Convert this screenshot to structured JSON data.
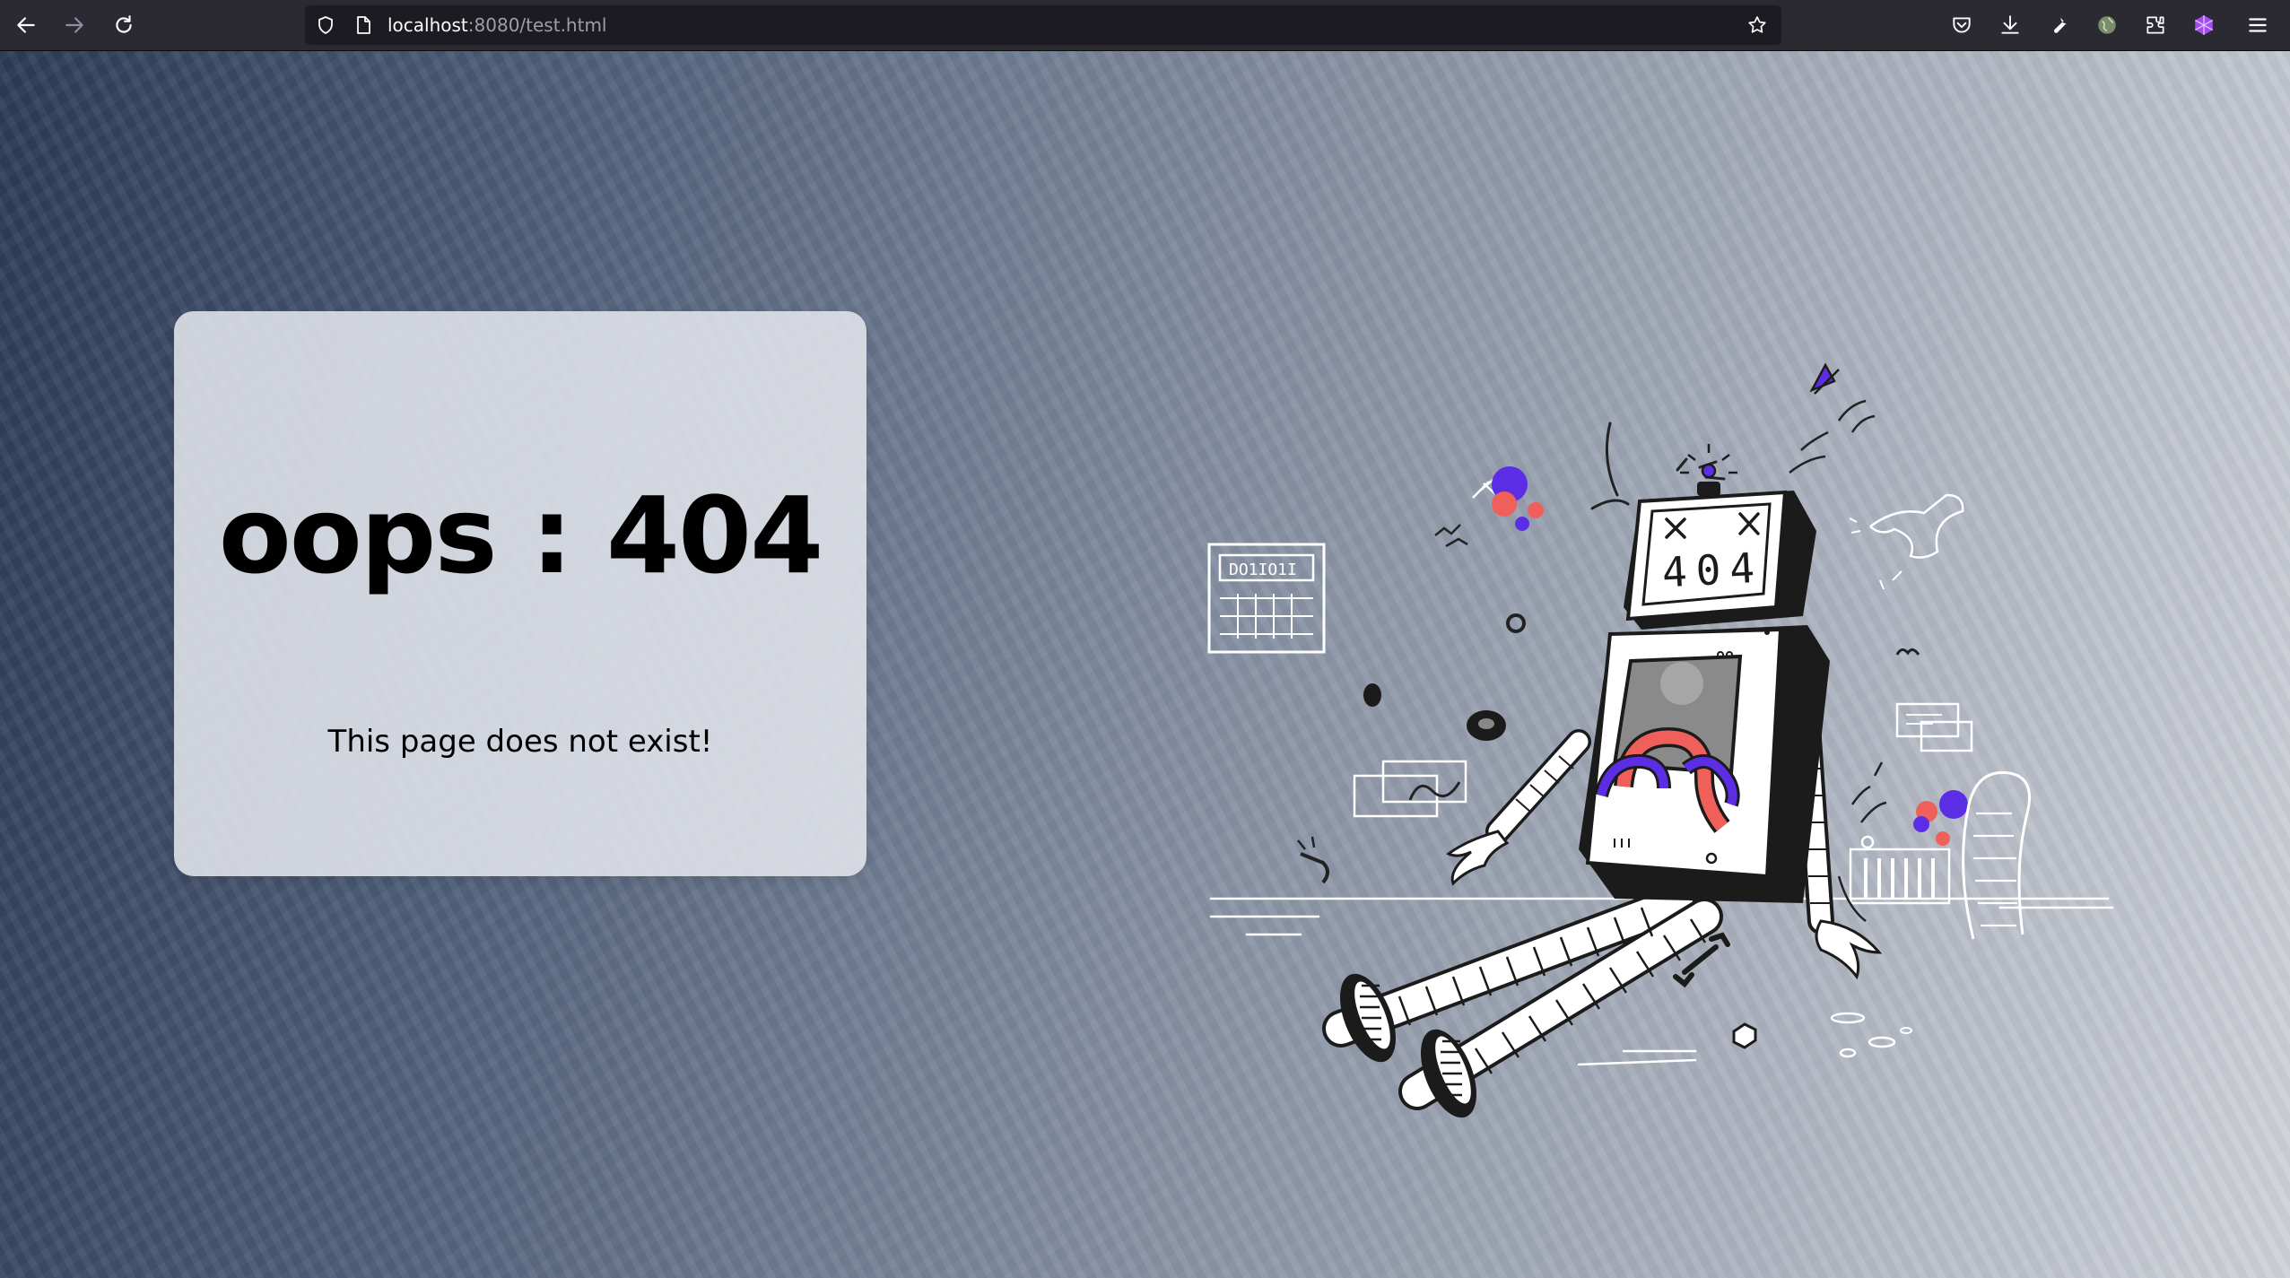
{
  "browser": {
    "url_host": "localhost",
    "url_rest": ":8080/test.html",
    "toolbar_icons": [
      "back-arrow-icon",
      "forward-arrow-icon",
      "reload-icon",
      "shield-icon",
      "page-icon",
      "bookmark-star-icon",
      "pocket-icon",
      "download-icon",
      "wrench-icon",
      "extension-globe-icon",
      "puzzle-icon",
      "extension-cube-icon",
      "hamburger-menu-icon"
    ]
  },
  "page": {
    "title": "oops : 404",
    "message": "This page does not exist!",
    "illustration": {
      "screen_text": "404",
      "panel_text": "DO1IO1I"
    }
  },
  "colors": {
    "card_bg": "#e2e5ea",
    "accent_purple": "#5b2ee6",
    "accent_coral": "#f0605a",
    "toolbar_bg": "#2b2a33",
    "urlbar_bg": "#1c1b22"
  }
}
